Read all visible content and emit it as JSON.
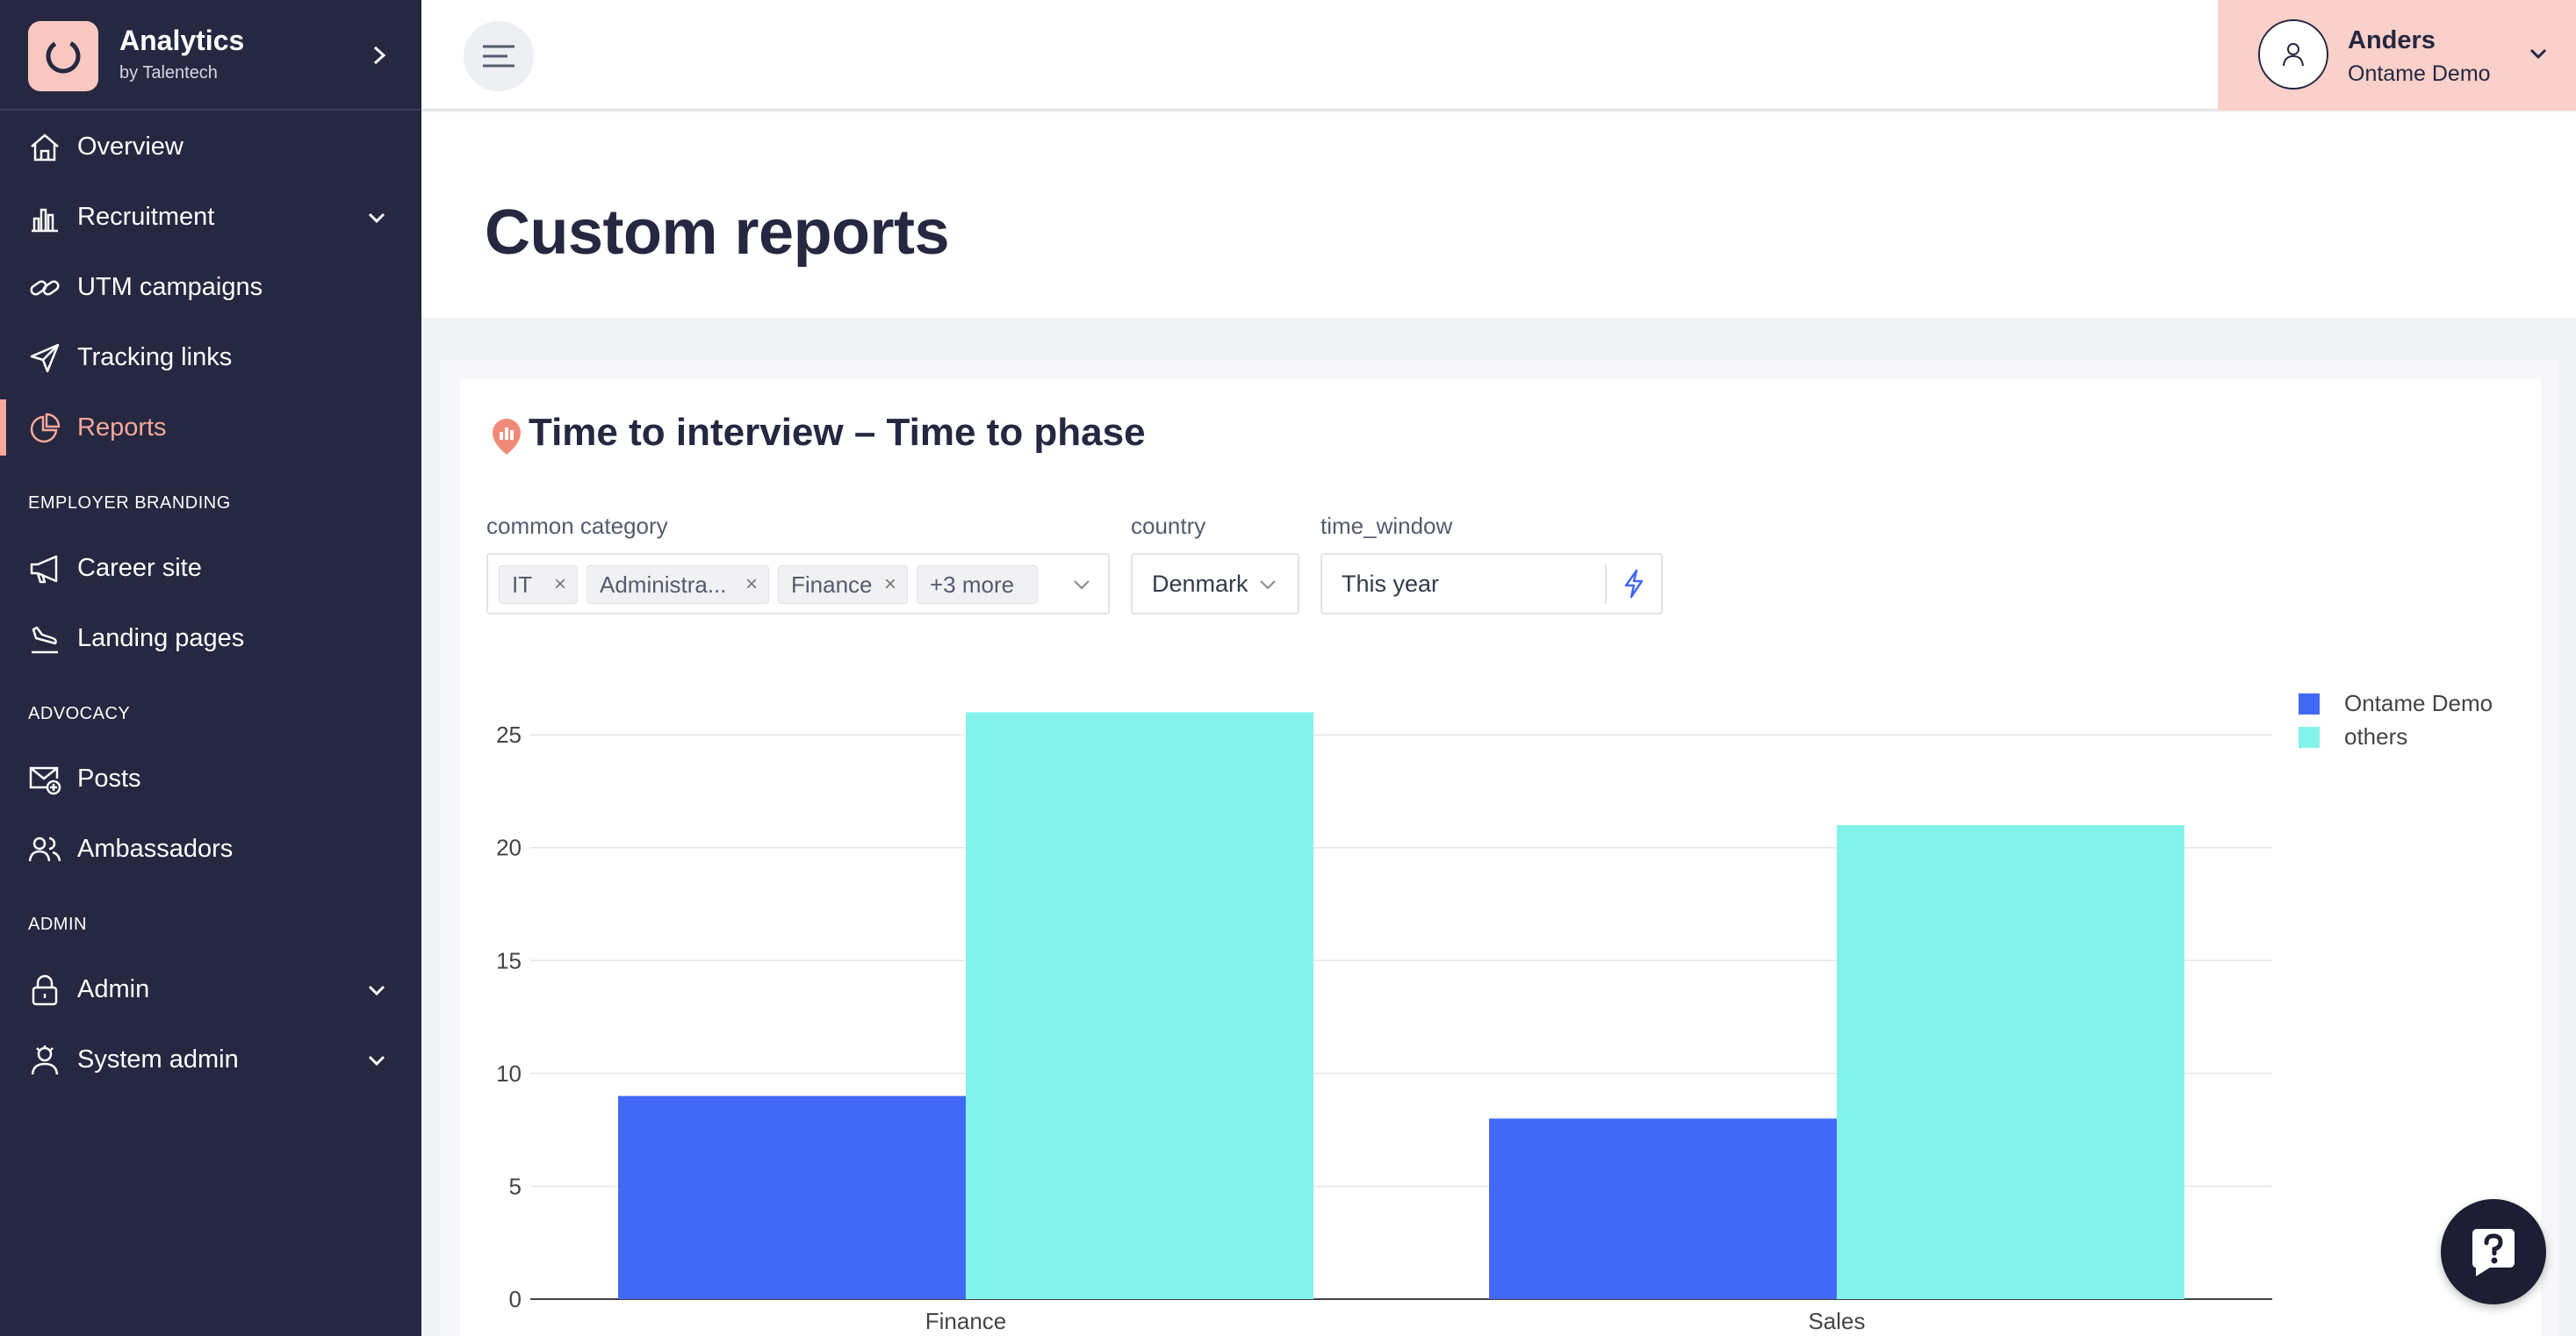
{
  "brand": {
    "title": "Analytics",
    "subtitle": "by Talentech"
  },
  "sidebar": {
    "items": [
      {
        "label": "Overview"
      },
      {
        "label": "Recruitment"
      },
      {
        "label": "UTM campaigns"
      },
      {
        "label": "Tracking links"
      },
      {
        "label": "Reports"
      },
      {
        "label": "Career site"
      },
      {
        "label": "Landing pages"
      },
      {
        "label": "Posts"
      },
      {
        "label": "Ambassadors"
      },
      {
        "label": "Admin"
      },
      {
        "label": "System admin"
      }
    ],
    "sections": [
      "EMPLOYER BRANDING",
      "ADVOCACY",
      "ADMIN"
    ],
    "active_item": "Reports"
  },
  "user": {
    "name": "Anders",
    "org": "Ontame Demo"
  },
  "page": {
    "title": "Custom reports"
  },
  "report": {
    "title": "Time to interview – Time to phase",
    "filters": {
      "category": {
        "label": "common category",
        "tags": [
          "IT",
          "Administra...",
          "Finance"
        ],
        "more": "+3 more"
      },
      "country": {
        "label": "country",
        "value": "Denmark"
      },
      "time_window": {
        "label": "time_window",
        "value": "This year"
      }
    }
  },
  "colors": {
    "sidebar": "#262740",
    "accent": "#f4a99b",
    "series_ontame": "#4169f5",
    "series_others": "#83f2ea",
    "user_box": "#f9d0ca"
  },
  "chart_data": {
    "type": "bar",
    "categories": [
      "Finance",
      "Sales"
    ],
    "series": [
      {
        "name": "Ontame Demo",
        "values": [
          9,
          8
        ]
      },
      {
        "name": "others",
        "values": [
          26,
          21
        ]
      }
    ],
    "ylim": [
      0,
      28
    ],
    "yticks": [
      0,
      5,
      10,
      15,
      20,
      25
    ],
    "grid": true,
    "legend": "top-right"
  }
}
